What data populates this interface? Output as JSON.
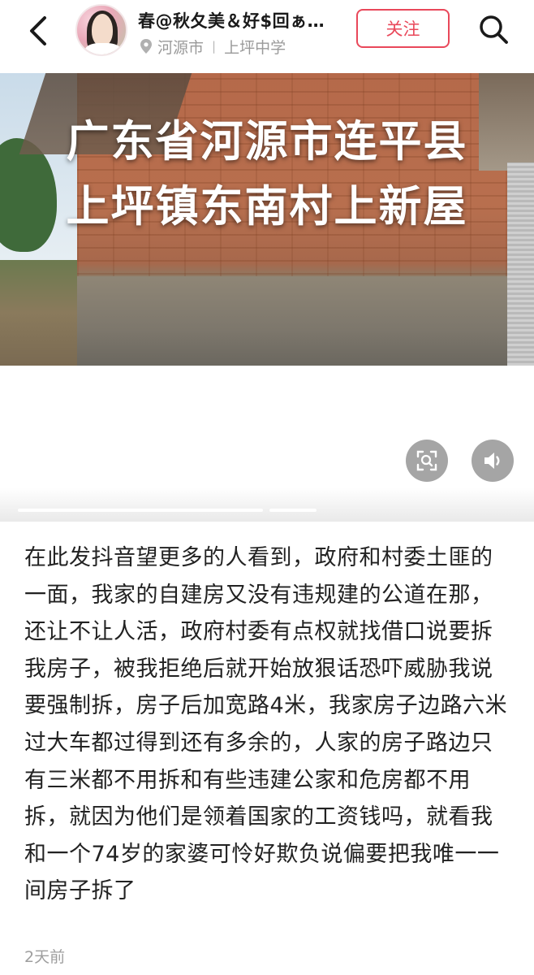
{
  "header": {
    "username": "春@秋夂美＆好$回ぁ…",
    "location_city": "河源市",
    "location_place": "上坪中学",
    "follow_label": "关注"
  },
  "media": {
    "overlay_line1": "广东省河源市连平县",
    "overlay_line2": "上坪镇东南村上新屋"
  },
  "post": {
    "body": "在此发抖音望更多的人看到，政府和村委土匪的一面，我家的自建房又没有违规建的公道在那，还让不让人活，政府村委有点权就找借口说要拆我房子，被我拒绝后就开始放狠话恐吓威胁我说要强制拆，房子后加宽路4米，我家房子边路六米过大车都过得到还有多余的，人家的房子路边只有三米都不用拆和有些违建公家和危房都不用拆，就因为他们是领着国家的工资钱吗，就看我和一个74岁的家婆可怜好欺负说偏要把我唯一一间房子拆了",
    "time": "2天前"
  },
  "icons": {
    "back": "chevron-left-icon",
    "search": "search-icon",
    "location": "location-pin-icon",
    "scan": "scan-icon",
    "volume": "volume-icon"
  },
  "colors": {
    "accent": "#e9485a",
    "text": "#222222",
    "muted": "#9a9a9a"
  }
}
